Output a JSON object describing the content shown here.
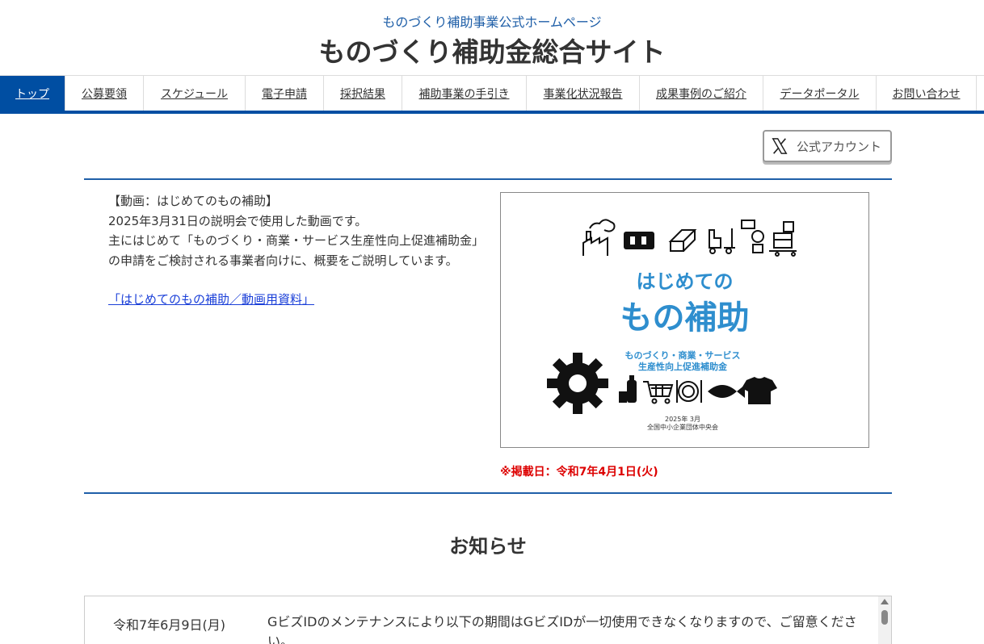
{
  "header": {
    "subtitle": "ものづくり補助事業公式ホームページ",
    "title": "ものづくり補助金総合サイト"
  },
  "nav": {
    "items": [
      {
        "label": "トップ",
        "active": true
      },
      {
        "label": "公募要領"
      },
      {
        "label": "スケジュール"
      },
      {
        "label": "電子申請"
      },
      {
        "label": "採択結果"
      },
      {
        "label": "補助事業の手引き"
      },
      {
        "label": "事業化状況報告"
      },
      {
        "label": "成果事例のご紹介"
      },
      {
        "label": "データポータル"
      },
      {
        "label": "お問い合わせ"
      }
    ]
  },
  "social": {
    "x_label": "公式アカウント",
    "icon": "x-logo-icon"
  },
  "intro": {
    "heading": "【動画：はじめてのもの補助】",
    "line1": "2025年3月31日の説明会で使用した動画です。",
    "line2": "主にはじめて「ものづくり・商業・サービス生産性向上促進補助金」の申請をご検討される事業者向けに、概要をご説明しています。",
    "link": "「はじめてのもの補助／動画用資料」"
  },
  "thumbnail": {
    "title_line1": "はじめての",
    "title_line2": "もの補助",
    "sub_line1": "ものづくり・商業・サービス",
    "sub_line2": "生産性向上促進補助金",
    "date": "2025年 3月",
    "org": "全国中小企業団体中央会"
  },
  "posted": "※掲載日：令和7年4月1日(火)",
  "news": {
    "section_title": "お知らせ",
    "items": [
      {
        "date": "令和7年6月9日(月)",
        "text": "GビズIDのメンテナンスにより以下の期間はGビズIDが一切使用できなくなりますので、ご留意ください。"
      }
    ]
  },
  "colors": {
    "brand_blue": "#004ea2",
    "accent_blue": "#2e8ece",
    "alert_red": "#dd0000"
  }
}
